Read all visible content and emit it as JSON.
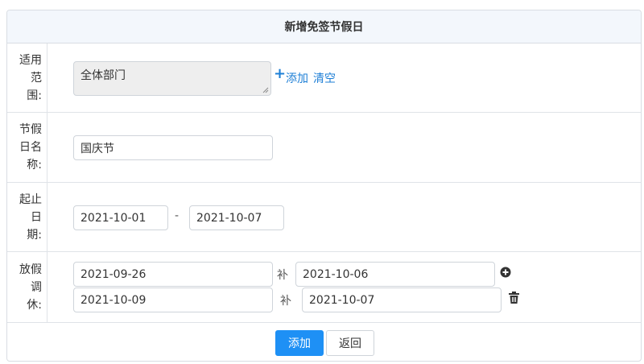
{
  "panel": {
    "title": "新增免签节假日"
  },
  "scope": {
    "label": "适用范围:",
    "value": "全体部门",
    "add_label": "添加",
    "clear_label": "清空"
  },
  "holiday_name": {
    "label": "节假日名称:",
    "value": "国庆节"
  },
  "date_range": {
    "label": "起止日期:",
    "start": "2021-10-01",
    "separator": "-",
    "end": "2021-10-07"
  },
  "swap": {
    "label": "放假调休:",
    "rows": [
      {
        "date": "2021-09-26",
        "make_up_label": "补",
        "make_up_date": "2021-10-06"
      },
      {
        "date": "2021-10-09",
        "make_up_label": "补",
        "make_up_date": "2021-10-07"
      }
    ]
  },
  "actions": {
    "submit_label": "添加",
    "back_label": "返回"
  },
  "colors": {
    "accent": "#1e90f5",
    "link": "#1e7fd6",
    "header_bg": "#f3f7fc"
  },
  "icons": {
    "add_row": "plus-circle-icon",
    "delete_row": "trash-icon",
    "add_scope": "plus-icon"
  }
}
